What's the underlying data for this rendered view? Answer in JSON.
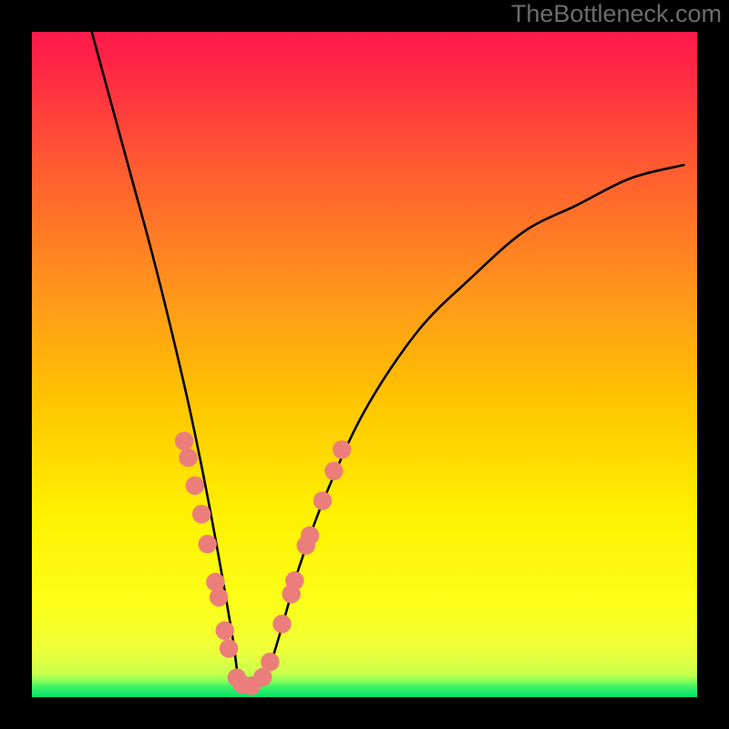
{
  "watermark": "TheBottleneck.com",
  "chart_data": {
    "type": "line",
    "title": "",
    "xlabel": "",
    "ylabel": "",
    "xlim": [
      0,
      1
    ],
    "ylim": [
      0,
      1
    ],
    "background": {
      "top_color": "#ff1b4c",
      "through": [
        "#ff6e2a",
        "#ffc300",
        "#fff700",
        "#f6ff34",
        "#dcff46"
      ],
      "bottom_color": "#00e36a",
      "thin_bottom_band": true
    },
    "series": [
      {
        "name": "curve",
        "color": "#000000",
        "x": [
          0.09,
          0.12,
          0.15,
          0.18,
          0.21,
          0.24,
          0.27,
          0.3,
          0.31,
          0.317,
          0.325,
          0.335,
          0.355,
          0.38,
          0.4,
          0.44,
          0.5,
          0.58,
          0.66,
          0.74,
          0.82,
          0.9,
          0.98
        ],
        "y": [
          1.0,
          0.89,
          0.78,
          0.67,
          0.55,
          0.42,
          0.27,
          0.1,
          0.03,
          0.016,
          0.015,
          0.018,
          0.04,
          0.12,
          0.19,
          0.3,
          0.43,
          0.55,
          0.63,
          0.7,
          0.74,
          0.78,
          0.8
        ]
      }
    ],
    "markers": {
      "name": "dots",
      "color": "#eb7e7a",
      "radius_norm": 0.014,
      "points": [
        {
          "x": 0.229,
          "y": 0.385
        },
        {
          "x": 0.235,
          "y": 0.36
        },
        {
          "x": 0.245,
          "y": 0.318
        },
        {
          "x": 0.255,
          "y": 0.275
        },
        {
          "x": 0.264,
          "y": 0.23
        },
        {
          "x": 0.276,
          "y": 0.173
        },
        {
          "x": 0.281,
          "y": 0.15
        },
        {
          "x": 0.29,
          "y": 0.1
        },
        {
          "x": 0.296,
          "y": 0.073
        },
        {
          "x": 0.308,
          "y": 0.029
        },
        {
          "x": 0.316,
          "y": 0.019
        },
        {
          "x": 0.33,
          "y": 0.017
        },
        {
          "x": 0.347,
          "y": 0.03
        },
        {
          "x": 0.358,
          "y": 0.053
        },
        {
          "x": 0.376,
          "y": 0.11
        },
        {
          "x": 0.39,
          "y": 0.155
        },
        {
          "x": 0.395,
          "y": 0.175
        },
        {
          "x": 0.412,
          "y": 0.228
        },
        {
          "x": 0.418,
          "y": 0.243
        },
        {
          "x": 0.437,
          "y": 0.295
        },
        {
          "x": 0.454,
          "y": 0.34
        },
        {
          "x": 0.466,
          "y": 0.372
        }
      ]
    }
  }
}
